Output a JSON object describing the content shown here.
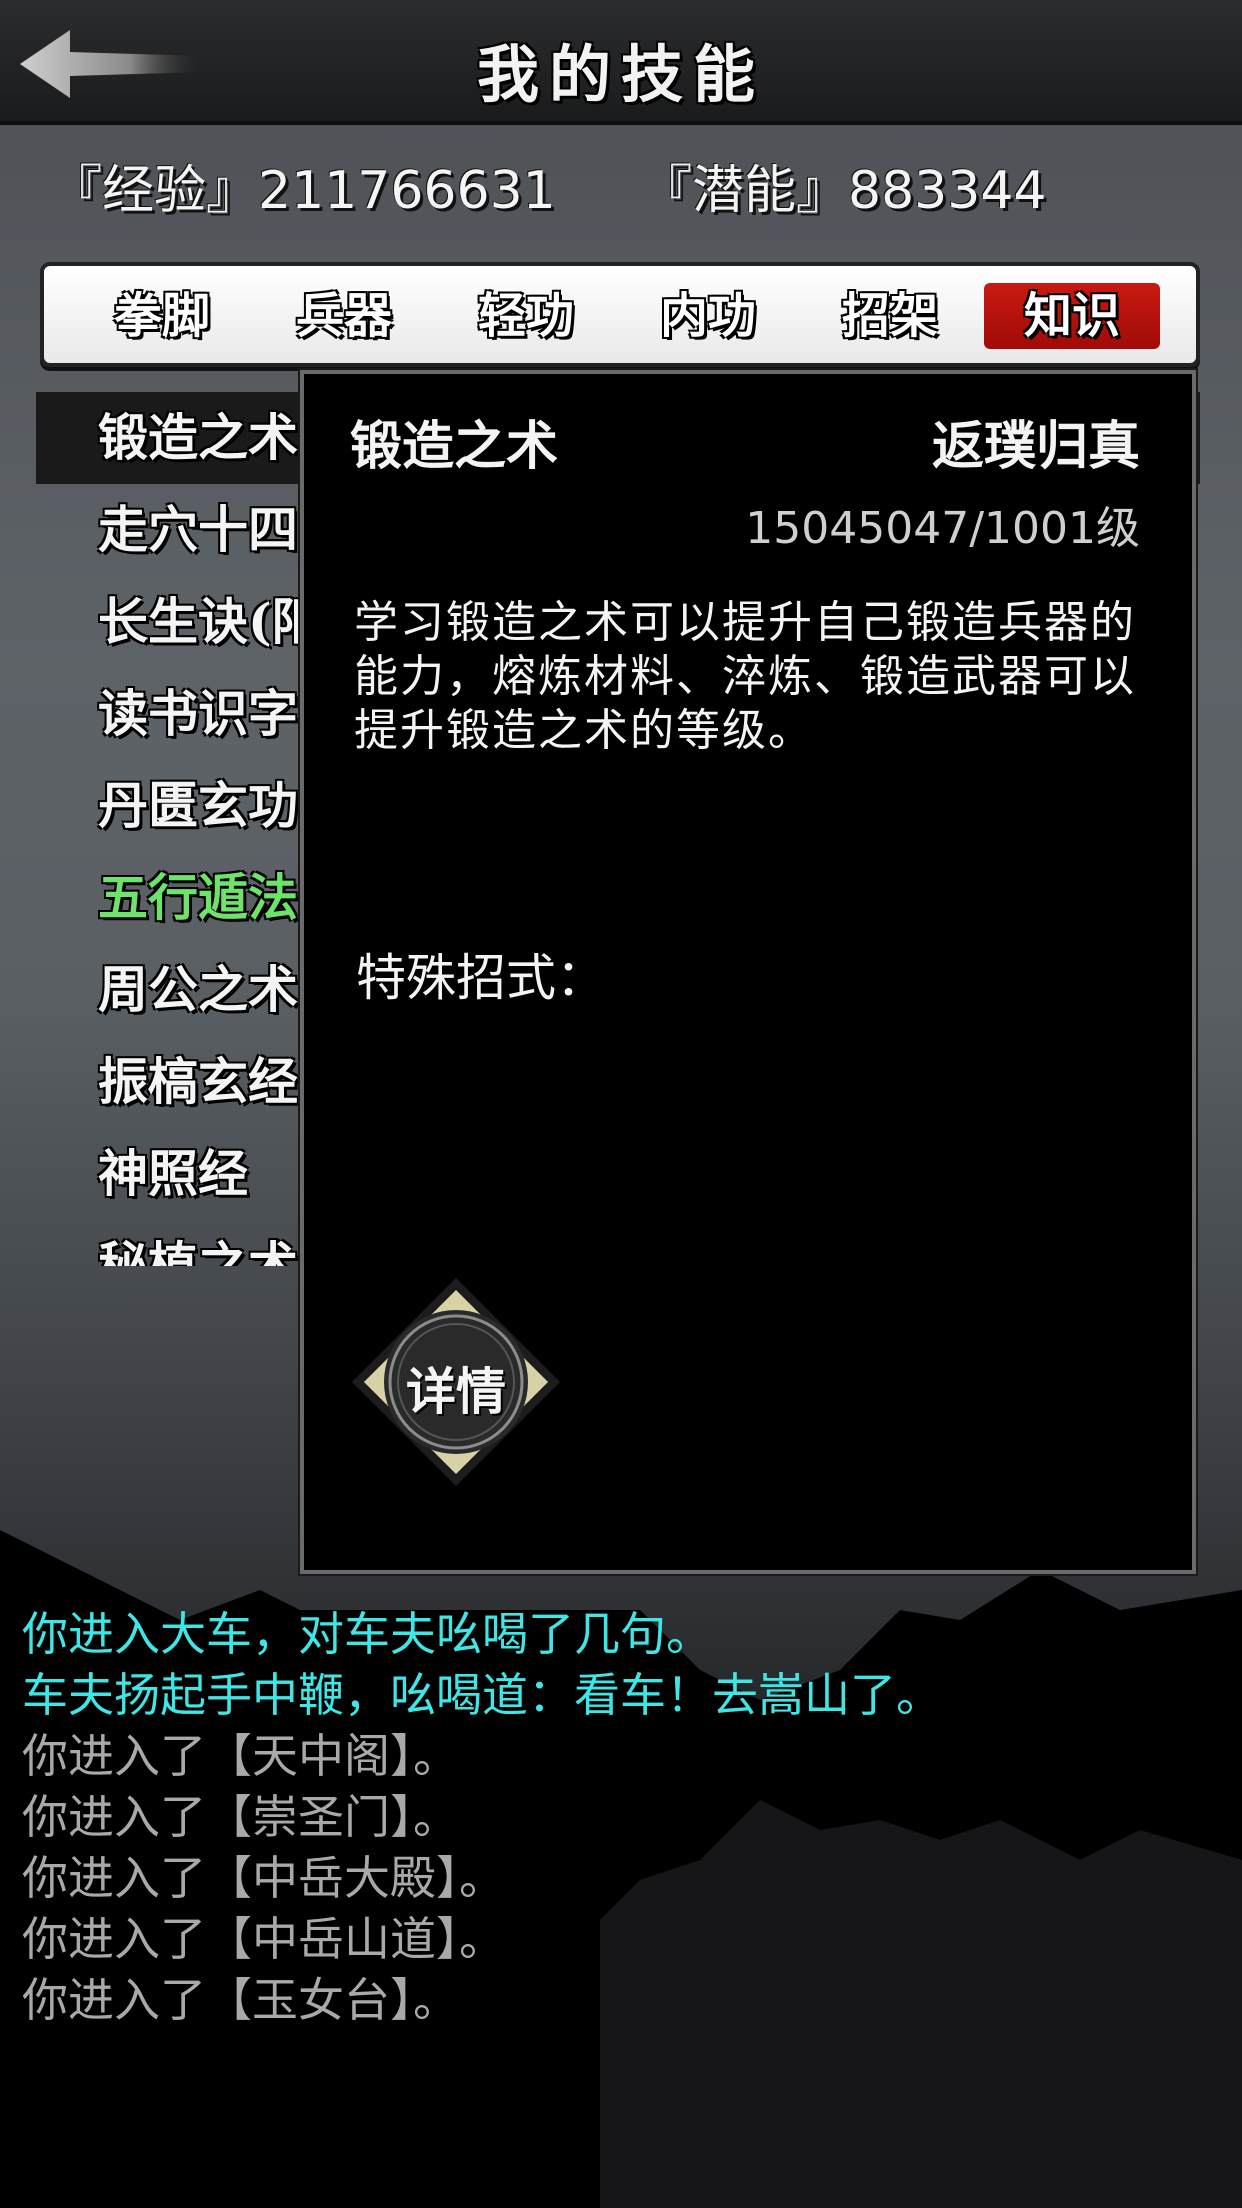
{
  "header": {
    "title": "我的技能"
  },
  "stats": {
    "exp": "『经验』211766631",
    "potential": "『潜能』883344"
  },
  "tabs": [
    {
      "label": "拳脚",
      "active": false
    },
    {
      "label": "兵器",
      "active": false
    },
    {
      "label": "轻功",
      "active": false
    },
    {
      "label": "内功",
      "active": false
    },
    {
      "label": "招架",
      "active": false
    },
    {
      "label": "知识",
      "active": true
    }
  ],
  "skills": [
    {
      "label": "锻造之术",
      "selected": true
    },
    {
      "label": "走穴十四"
    },
    {
      "label": "长生诀(阳"
    },
    {
      "label": "读书识字"
    },
    {
      "label": "丹匮玄功"
    },
    {
      "label": "五行遁法",
      "color": "green"
    },
    {
      "label": "周公之术"
    },
    {
      "label": "振槁玄经"
    },
    {
      "label": "神照经"
    },
    {
      "label": "秘植之术"
    }
  ],
  "popup": {
    "name": "锻造之术",
    "rank": "返璞归真",
    "level": "15045047/1001级",
    "description": "学习锻造之术可以提升自己锻造兵器的能力，熔炼材料、淬炼、锻造武器可以提升锻造之术的等级。",
    "special_label": "特殊招式：",
    "detail_label": "详情"
  },
  "log": [
    {
      "text": "你进入大车，对车夫吆喝了几句。",
      "color": "cyan"
    },
    {
      "text": "车夫扬起手中鞭，吆喝道：看车！去嵩山了。",
      "color": "cyan"
    },
    {
      "text": "你进入了【天中阁】。",
      "color": "gray"
    },
    {
      "text": "你进入了【崇圣门】。",
      "color": "gray"
    },
    {
      "text": "你进入了【中岳大殿】。",
      "color": "gray"
    },
    {
      "text": "你进入了【中岳山道】。",
      "color": "gray"
    },
    {
      "text": "你进入了【玉女台】。",
      "color": "gray"
    }
  ],
  "icons": {
    "back": "back-arrow-icon",
    "detail": "diamond-seal-icon"
  },
  "colors": {
    "active_tab": "#b8120c",
    "highlight_green": "#6ee36a",
    "log_cyan": "#3fe6e6",
    "log_gray": "#a9a9a9"
  }
}
